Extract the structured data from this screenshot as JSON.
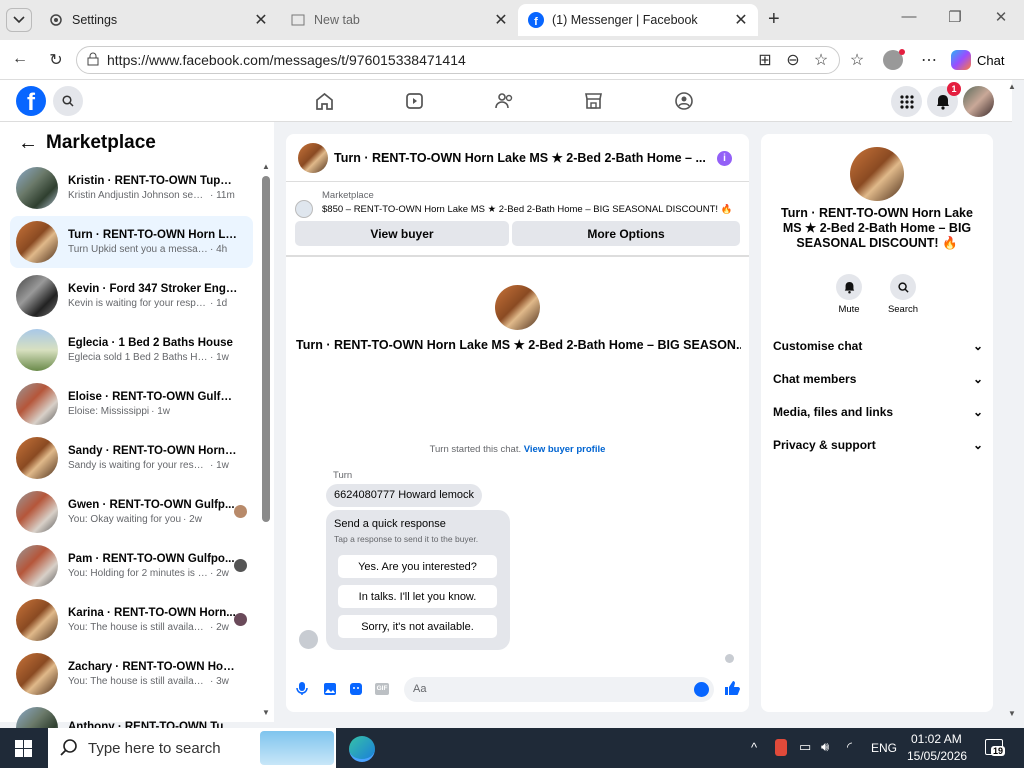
{
  "browser": {
    "tabs": [
      {
        "label": "Settings"
      },
      {
        "label": "New tab"
      },
      {
        "label": "(1) Messenger | Facebook"
      }
    ],
    "url": "https://www.facebook.com/messages/t/976015338471414",
    "chat_button": "Chat"
  },
  "fb": {
    "notification_count": "1",
    "brand_color": "#0866ff"
  },
  "marketplace": {
    "title": "Marketplace",
    "conversations": [
      {
        "name": "Kristin · RENT-TO-OWN Tupelo ...",
        "preview": "Kristin Andjustin Johnson sent y...",
        "time": "· 11m"
      },
      {
        "name": "Turn · RENT-TO-OWN Horn Lak...",
        "preview": "Turn Upkid sent you a message ab...",
        "time": "· 4h"
      },
      {
        "name": "Kevin · Ford 347 Stroker Engine...",
        "preview": "Kevin is waiting for your response.",
        "time": "· 1d"
      },
      {
        "name": "Eglecia · 1 Bed 2 Baths House",
        "preview": "Eglecia sold 1 Bed 2 Baths House.",
        "time": "· 1w"
      },
      {
        "name": "Eloise · RENT-TO-OWN Gulfpor...",
        "preview": "Eloise: Mississippi",
        "time": "· 1w"
      },
      {
        "name": "Sandy · RENT-TO-OWN Horn L...",
        "preview": "Sandy is waiting for your response.",
        "time": "· 1w"
      },
      {
        "name": "Gwen · RENT-TO-OWN Gulfp...",
        "preview": "You: Okay waiting for you",
        "time": "· 2w"
      },
      {
        "name": "Pam · RENT-TO-OWN Gulfpo...",
        "preview": "You: Holding for 2 minutes is n...",
        "time": "· 2w"
      },
      {
        "name": "Karina · RENT-TO-OWN Horn...",
        "preview": "You: The house is still available ...",
        "time": "· 2w"
      },
      {
        "name": "Zachary · RENT-TO-OWN Horn ...",
        "preview": "You: The house is still available for...",
        "time": "· 3w"
      },
      {
        "name": "Anthony · RENT-TO-OWN Tupe...",
        "preview": "",
        "time": ""
      }
    ]
  },
  "chat": {
    "header_title": "Turn · RENT-TO-OWN Horn Lake MS ★ 2-Bed 2-Bath Home – ...",
    "listing_source": "Marketplace",
    "listing_text": "$850 – RENT-TO-OWN Horn Lake MS ★ 2-Bed 2-Bath Home – BIG SEASONAL DISCOUNT! 🔥",
    "view_buyer": "View buyer",
    "more_options": "More Options",
    "center_title": "Turn · RENT-TO-OWN Horn Lake MS ★ 2-Bed 2-Bath Home – BIG SEASON...",
    "started_text": "Turn started this chat.",
    "view_buyer_profile": "View buyer profile",
    "sender": "Turn",
    "message": "6624080777 Howard lemock",
    "quick_title": "Send a quick response",
    "quick_sub": "Tap a response to send it to the buyer.",
    "quick_responses": [
      "Yes. Are you interested?",
      "In talks. I'll let you know.",
      "Sorry, it's not available."
    ],
    "input_placeholder": "Aa",
    "gif_label": "GIF"
  },
  "details": {
    "title": "Turn · RENT-TO-OWN Horn Lake MS ★ 2-Bed 2-Bath Home – BIG SEASONAL DISCOUNT! 🔥",
    "mute": "Mute",
    "search": "Search",
    "menu": [
      "Customise chat",
      "Chat members",
      "Media, files and links",
      "Privacy & support"
    ]
  },
  "taskbar": {
    "search_placeholder": "Type here to search",
    "language": "ENG",
    "time": "01:02 AM",
    "date": "15/05/2026",
    "notif_count": "19"
  }
}
